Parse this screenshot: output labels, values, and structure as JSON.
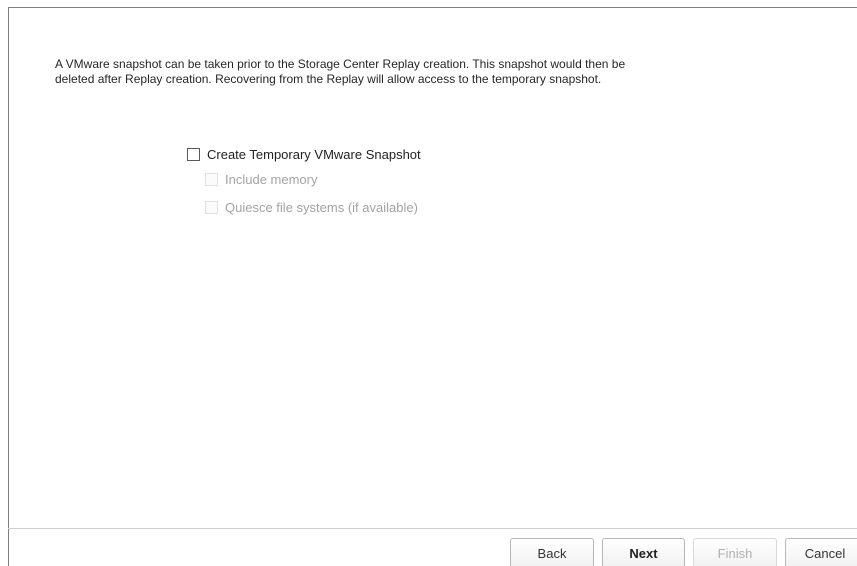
{
  "description": "A VMware snapshot can be taken prior to the Storage Center Replay creation. This snapshot would then be deleted after Replay creation. Recovering from the Replay will allow access to the temporary snapshot.",
  "options": {
    "create_snapshot": {
      "label": "Create Temporary VMware Snapshot",
      "checked": false,
      "enabled": true
    },
    "include_memory": {
      "label": "Include memory",
      "checked": false,
      "enabled": false
    },
    "quiesce": {
      "label": "Quiesce file systems (if available)",
      "checked": false,
      "enabled": false
    }
  },
  "buttons": {
    "back": "Back",
    "next": "Next",
    "finish": "Finish",
    "cancel": "Cancel"
  }
}
